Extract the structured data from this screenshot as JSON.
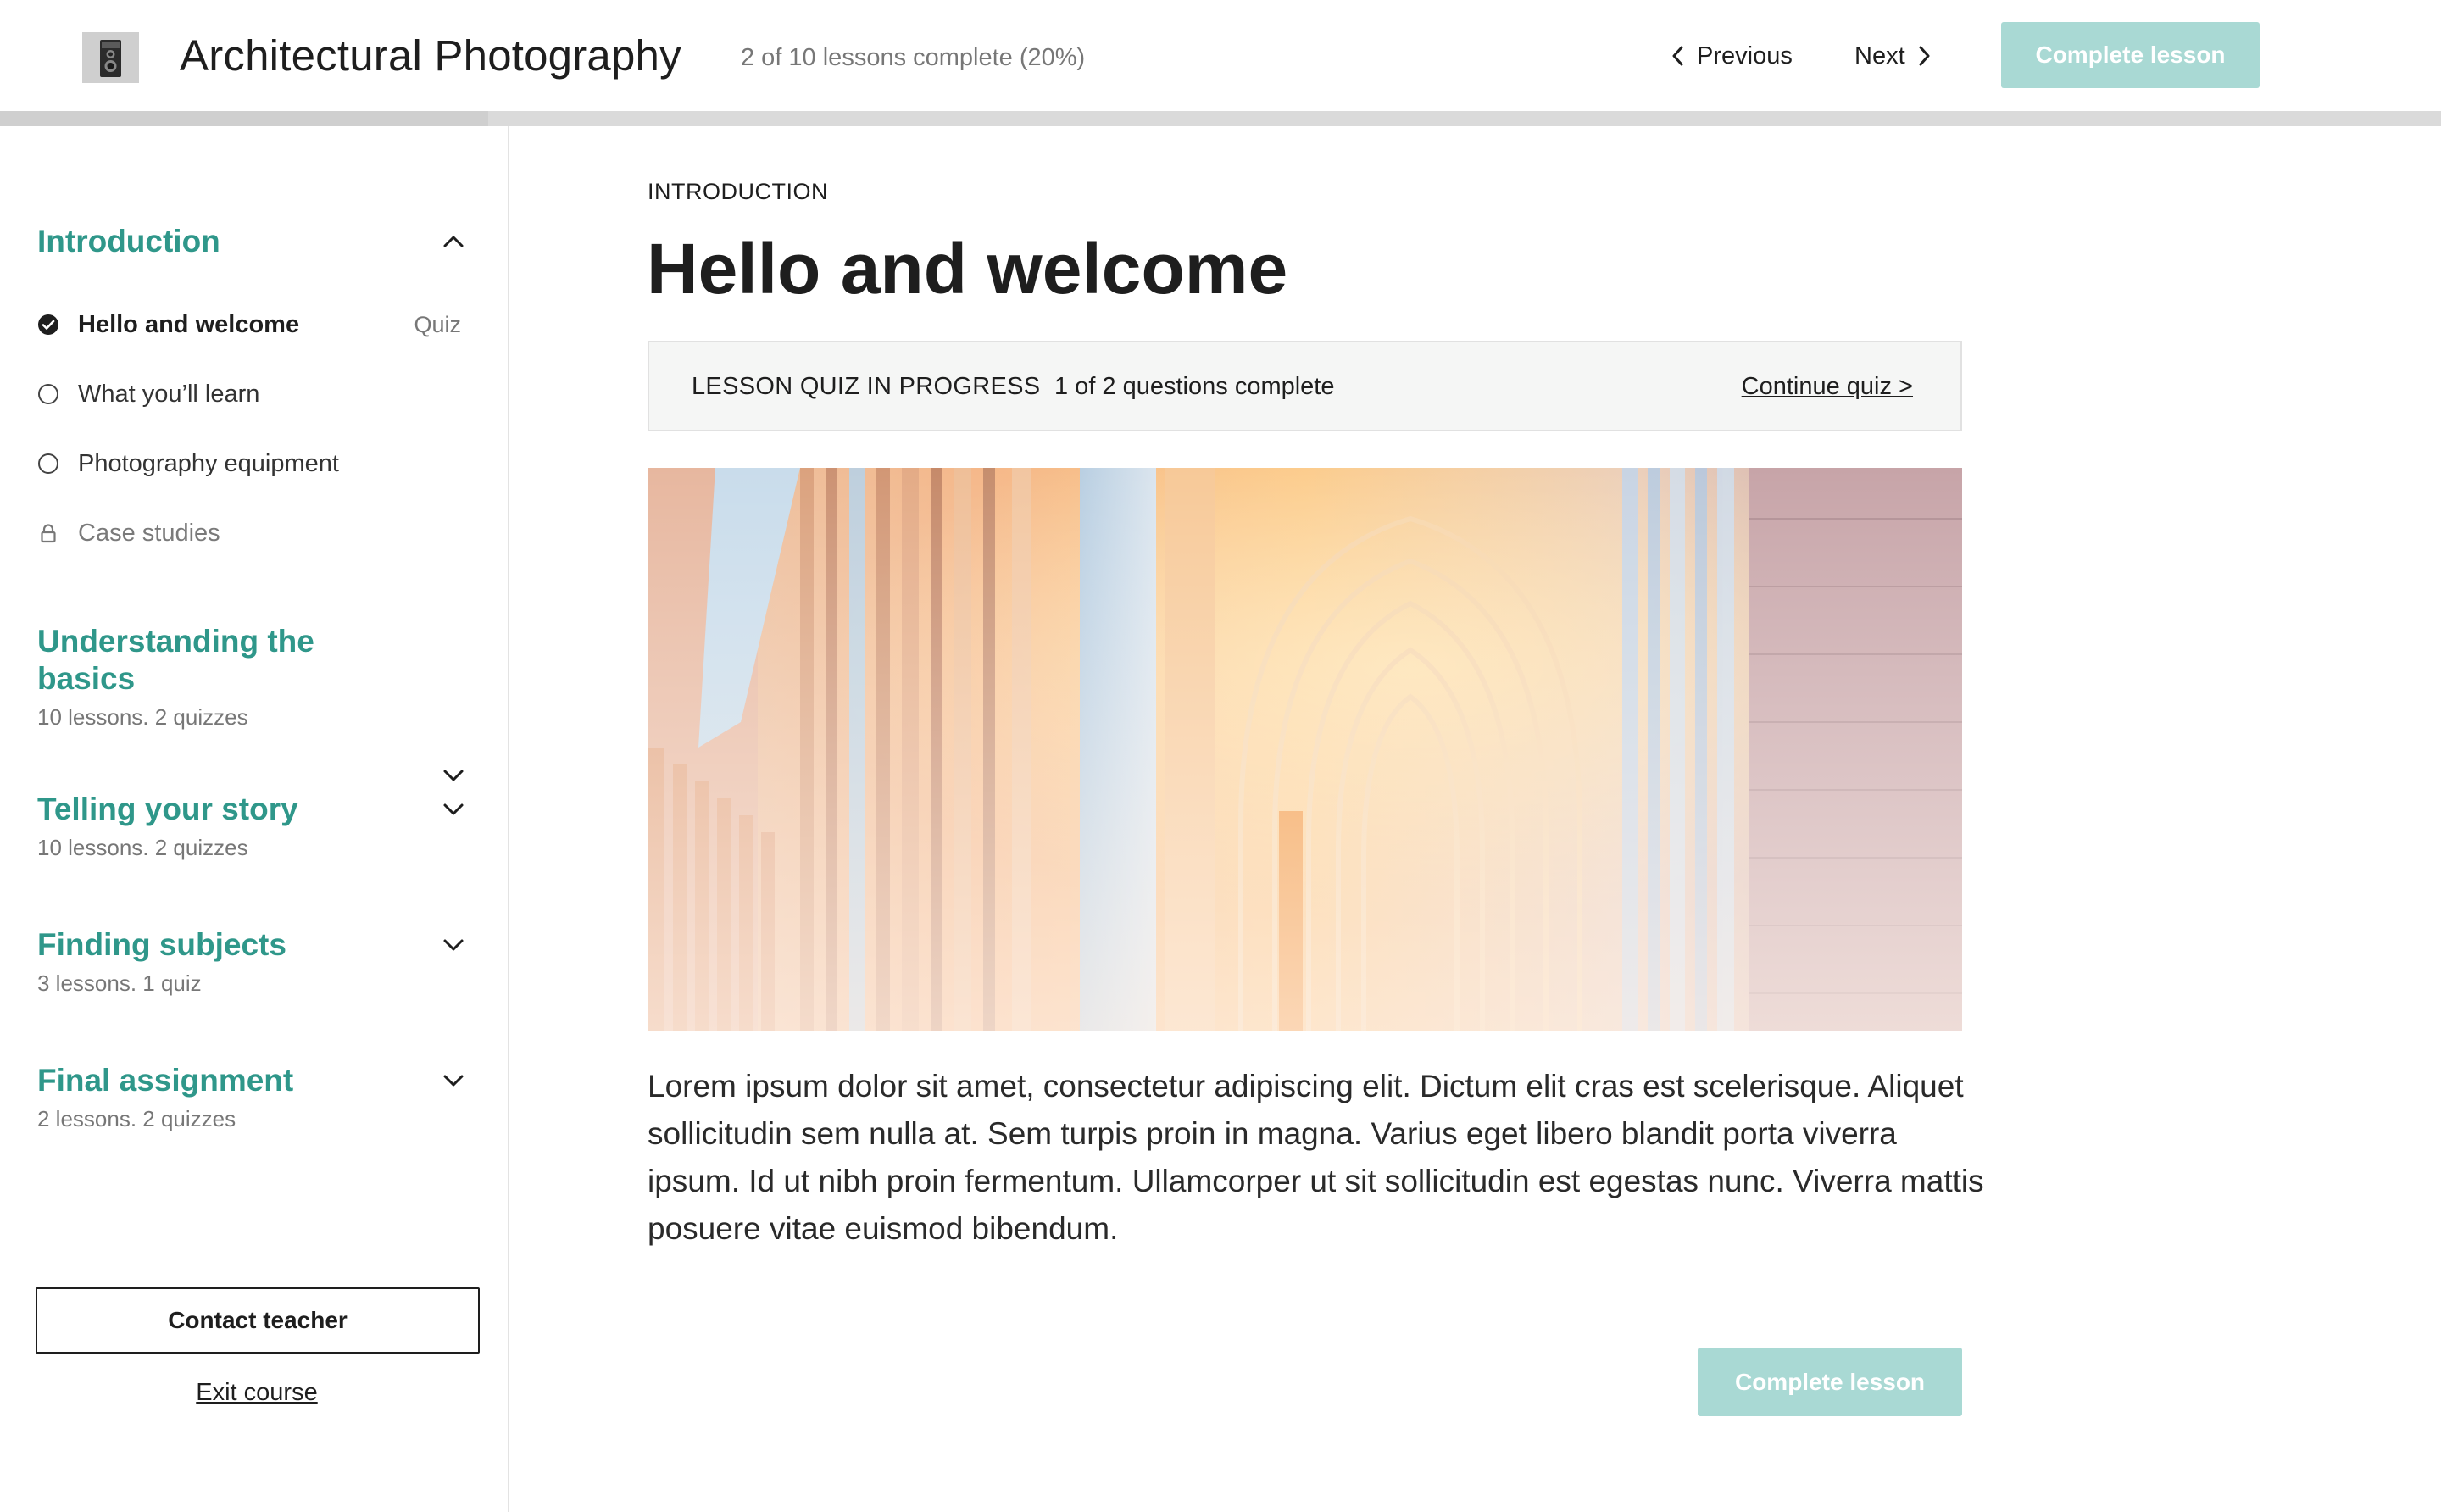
{
  "header": {
    "course_title": "Architectural Photography",
    "progress_text": "2 of 10 lessons complete (20%)",
    "progress_fraction": 0.2,
    "previous_label": "Previous",
    "next_label": "Next",
    "complete_label": "Complete lesson",
    "logo_icon": "camera-icon"
  },
  "sidebar": {
    "sections": [
      {
        "title": "Introduction",
        "expanded": true,
        "lessons": [
          {
            "label": "Hello and welcome",
            "status": "complete",
            "active": true,
            "tag": "Quiz",
            "icon": "check-circle-icon"
          },
          {
            "label": "What you’ll learn",
            "status": "incomplete",
            "icon": "empty-circle-icon"
          },
          {
            "label": "Photography equipment",
            "status": "incomplete",
            "icon": "empty-circle-icon"
          },
          {
            "label": "Case studies",
            "status": "locked",
            "icon": "lock-icon"
          }
        ]
      },
      {
        "title": "Understanding the basics",
        "meta": "10 lessons. 2 quizzes",
        "expanded": false
      },
      {
        "title": "Telling your story",
        "meta": "10 lessons. 2 quizzes",
        "expanded": false
      },
      {
        "title": "Finding subjects",
        "meta": "3 lessons. 1 quiz",
        "expanded": false
      },
      {
        "title": "Final assignment",
        "meta": "2 lessons. 2 quizzes",
        "expanded": false
      }
    ],
    "contact_label": "Contact teacher",
    "exit_label": "Exit course"
  },
  "main": {
    "eyebrow": "INTRODUCTION",
    "title": "Hello and welcome",
    "quiz_banner": {
      "status": "LESSON QUIZ IN PROGRESS",
      "count": "1 of 2 questions complete",
      "link": "Continue quiz >"
    },
    "body": "Lorem ipsum dolor sit amet, consectetur adipiscing elit. Dictum elit cras est scelerisque. Aliquet sollicitudin sem nulla at. Sem turpis proin in magna. Varius eget libero blandit porta viverra ipsum. Id ut nibh proin fermentum. Ullamcorper ut sit sollicitudin est egestas nunc. Viverra mattis posuere vitae euismod bibendum.",
    "complete_label": "Complete lesson"
  },
  "colors": {
    "accent": "#2f978a",
    "button_disabled": "#a9d9d4",
    "text": "#1e1e1e",
    "muted": "#777777"
  }
}
